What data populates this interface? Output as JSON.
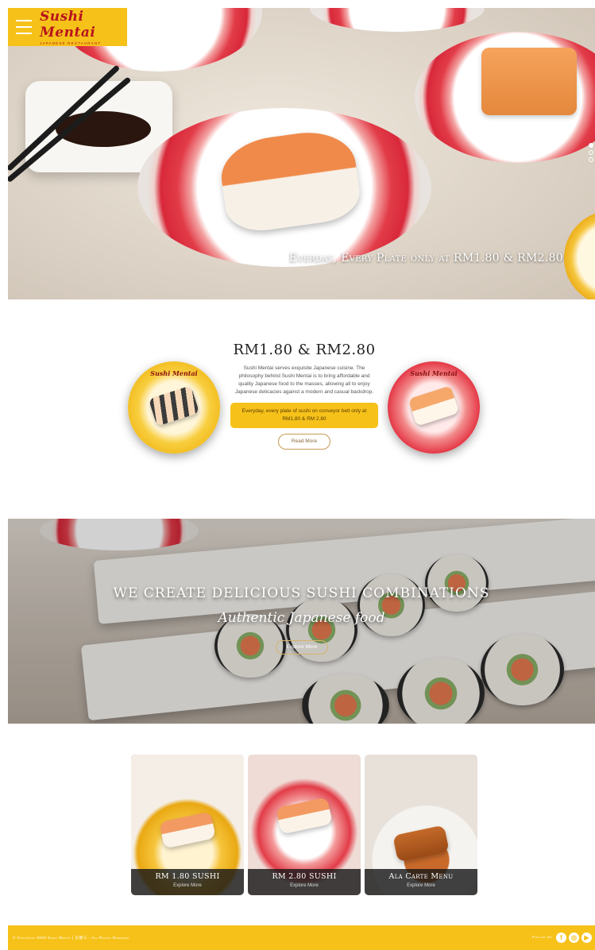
{
  "brand": {
    "name": "Sushi Mentai",
    "tagline": "JAPANESE RESTAURANT"
  },
  "hero": {
    "caption": "Everday, Every Plate only at RM1.80 & RM2.80",
    "slides": 3,
    "active_slide": 1
  },
  "promo": {
    "title": "RM1.80 & RM2.80",
    "description": "Sushi Mentai serves exquisite Japanese cuisine. The philosophy behind Sushi Mentai is to bring affordable and quality Japanese food to the masses, allowing all to enjoy Japanese delicacies against a modern and casual backdrop.",
    "highlight": "Everyday, every plate of sushi on conveyor belt only at RM1.80 & RM 2.80",
    "read_more": "Read More",
    "plate_logo": "Sushi Mentai"
  },
  "banner": {
    "title": "WE CREATE DELICIOUS SUSHI COMBINATIONS",
    "subtitle": "Authentic Japanese food",
    "button": "Explore More"
  },
  "cards": [
    {
      "title": "RM 1.80 SUSHI",
      "sub": "Explore More"
    },
    {
      "title": "RM 2.80 SUSHI",
      "sub": "Explore More"
    },
    {
      "title": "Ala Carte Menu",
      "sub": "Explore More"
    }
  ],
  "footer": {
    "copyright": "© Copyright 2020 Sushi Mentai | 天使三 - All Rights Reserved",
    "follow": "Follow Us",
    "social": [
      "facebook-icon",
      "instagram-icon",
      "youtube-icon"
    ]
  },
  "colors": {
    "accent": "#f6c21a",
    "brand_red": "#b8141d"
  }
}
